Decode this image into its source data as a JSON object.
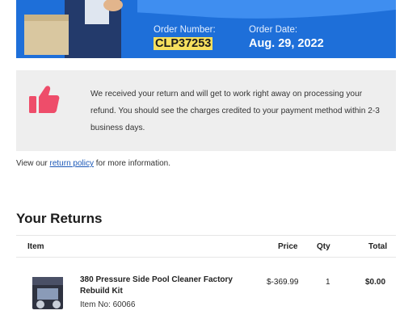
{
  "header": {
    "order_number_label": "Order Number:",
    "order_number": "CLP37253",
    "order_date_label": "Order Date:",
    "order_date": "Aug. 29, 2022",
    "colors": {
      "banner": "#1e6fd9",
      "highlight": "#f6e05e"
    }
  },
  "notice": {
    "icon": "thumbs-up-icon",
    "text": "We received your return and will get to work right away on processing your refund. You should see the charges credited to your payment method within 2-3 business days."
  },
  "policy": {
    "prefix": "View our ",
    "link": "return policy",
    "suffix": " for more information."
  },
  "returns": {
    "title": "Your Returns",
    "columns": {
      "item": "Item",
      "price": "Price",
      "qty": "Qty",
      "total": "Total"
    },
    "items": [
      {
        "name": "380 Pressure Side Pool Cleaner Factory Rebuild Kit",
        "sku": "Item No: 60066",
        "price": "$-369.99",
        "qty": "1",
        "total": "$0.00"
      }
    ]
  }
}
